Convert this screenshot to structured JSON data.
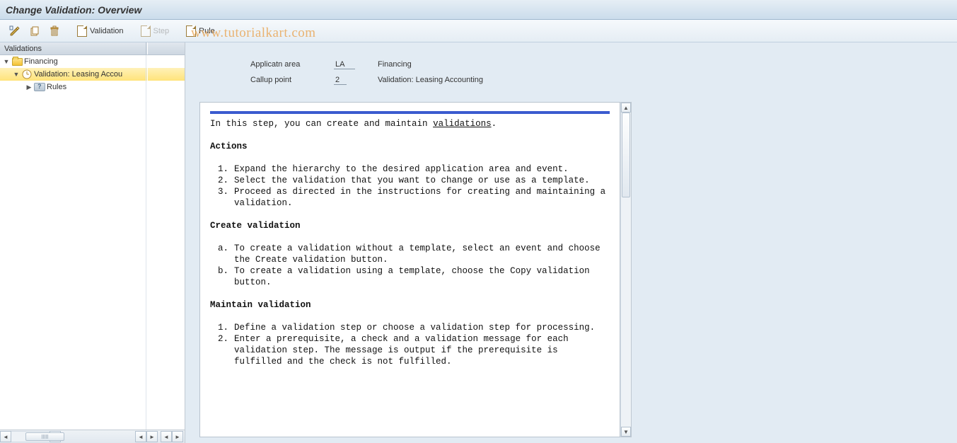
{
  "title": "Change Validation: Overview",
  "toolbar": {
    "validation_label": "Validation",
    "step_label": "Step",
    "rule_label": "Rule"
  },
  "tree": {
    "header": "Validations",
    "root": "Financing",
    "selected": "Validation: Leasing Accou",
    "rules": "Rules"
  },
  "form": {
    "app_label": "Applicatn area",
    "app_val": "LA",
    "app_desc": "Financing",
    "callup_label": "Callup point",
    "callup_val": "2",
    "callup_desc": "Validation: Leasing Accounting"
  },
  "doc": {
    "intro_pre": "In this step, you can create and maintain ",
    "intro_link": "validations",
    "intro_post": ".",
    "h_actions": "Actions",
    "a1": "Expand the hierarchy to the desired application area and event.",
    "a2": "Select the validation that you want to change or use as a template.",
    "a3": "Proceed as directed in the instructions for creating and maintaining a validation.",
    "h_create": "Create validation",
    "c1": "To create a validation without a template, select an event and choose the Create validation button.",
    "c2": "To create a validation using a template, choose the Copy validation button.",
    "h_maintain": "Maintain validation",
    "m1": "Define a validation step or choose a validation step for processing.",
    "m2": "Enter a prerequisite, a check and a validation message for each validation step. The message is output if the prerequisite is fulfilled and the check is not fulfilled."
  },
  "watermark": "www.tutorialkart.com"
}
